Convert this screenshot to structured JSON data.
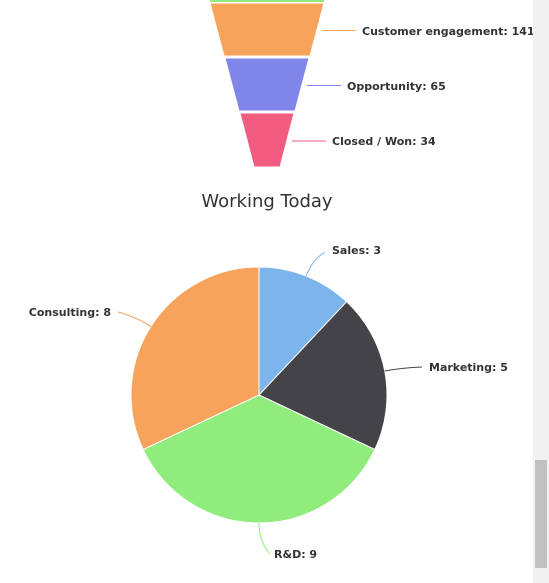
{
  "chart_data": [
    {
      "type": "funnel",
      "items": [
        {
          "name": "Customer engagement",
          "value": 141,
          "label": "Customer engagement: 141",
          "color": "#f7a35c"
        },
        {
          "name": "Opportunity",
          "value": 65,
          "label": "Opportunity: 65",
          "color": "#8085e9"
        },
        {
          "name": "Closed / Won",
          "value": 34,
          "label": "Closed / Won: 34",
          "color": "#f15c80"
        }
      ],
      "partial_top_color": "#90ed7d"
    },
    {
      "type": "pie",
      "title": "Working Today",
      "slices": [
        {
          "name": "Sales",
          "value": 3,
          "label": "Sales: 3",
          "color": "#7cb5ec"
        },
        {
          "name": "Marketing",
          "value": 5,
          "label": "Marketing: 5",
          "color": "#434348"
        },
        {
          "name": "R&D",
          "value": 9,
          "label": "R&D: 9",
          "color": "#90ed7d"
        },
        {
          "name": "Consulting",
          "value": 8,
          "label": "Consulting: 8",
          "color": "#f7a35c"
        }
      ]
    }
  ]
}
